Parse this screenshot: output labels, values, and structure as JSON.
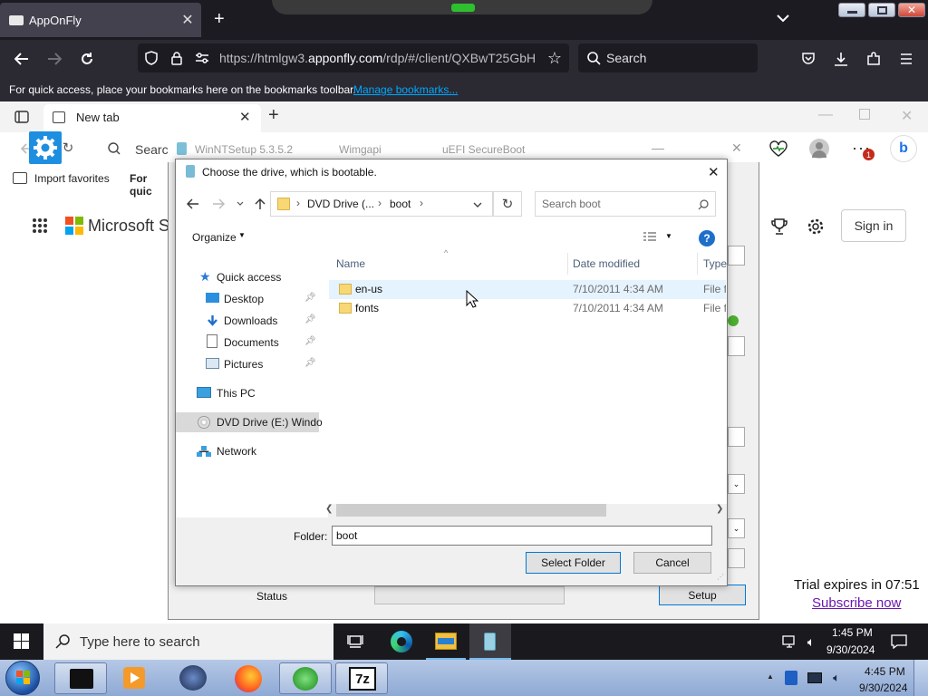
{
  "firefox": {
    "tab_title": "AppOnFly",
    "new_tab_symbol": "+",
    "url_prefix": "https://htmlgw3.",
    "url_domain": "apponfly.com",
    "url_suffix": "/rdp/#/client/QXBwT25GbH",
    "search_placeholder": "Search",
    "bookmarks_hint": "For quick access, place your bookmarks here on the bookmarks toolbar.",
    "bookmarks_link": "Manage bookmarks..."
  },
  "edge": {
    "tab_title": "New tab",
    "search_placeholder": "Search",
    "import_favorites": "Import favorites",
    "for_quick": "For quic",
    "store_name": "Microsoft St",
    "sign_in": "Sign in",
    "badge_count": "1"
  },
  "winnt": {
    "title": "WinNTSetup 5.3.5.2",
    "tab_wimgapi": "Wimgapi",
    "tab_uefi": "uEFI SecureBoot",
    "status_label": "Status",
    "setup_button": "Setup"
  },
  "dialog": {
    "title": "Choose the drive, which is bootable.",
    "breadcrumb": [
      "DVD Drive (...",
      "boot"
    ],
    "search_placeholder": "Search boot",
    "organize": "Organize",
    "columns": {
      "name": "Name",
      "date": "Date modified",
      "type": "Type"
    },
    "sidebar": {
      "quick_access": "Quick access",
      "desktop": "Desktop",
      "downloads": "Downloads",
      "documents": "Documents",
      "pictures": "Pictures",
      "this_pc": "This PC",
      "dvd_drive": "DVD Drive (E:) Windo",
      "network": "Network"
    },
    "files": [
      {
        "name": "en-us",
        "date": "7/10/2011 4:34 AM",
        "type": "File fo"
      },
      {
        "name": "fonts",
        "date": "7/10/2011 4:34 AM",
        "type": "File fo"
      }
    ],
    "folder_label": "Folder:",
    "folder_value": "boot",
    "select_button": "Select Folder",
    "cancel_button": "Cancel"
  },
  "trial": {
    "text": "Trial expires in 07:51",
    "link": "Subscribe now"
  },
  "taskbar_win10": {
    "search_placeholder": "Type here to search",
    "time": "1:45 PM",
    "date": "9/30/2024"
  },
  "taskbar_win7": {
    "time": "4:45 PM",
    "date": "9/30/2024",
    "app_7z": "7z"
  },
  "colors": {
    "accent": "#0078d7",
    "link": "#00a8ff",
    "edge_bg": "#ffffff"
  }
}
